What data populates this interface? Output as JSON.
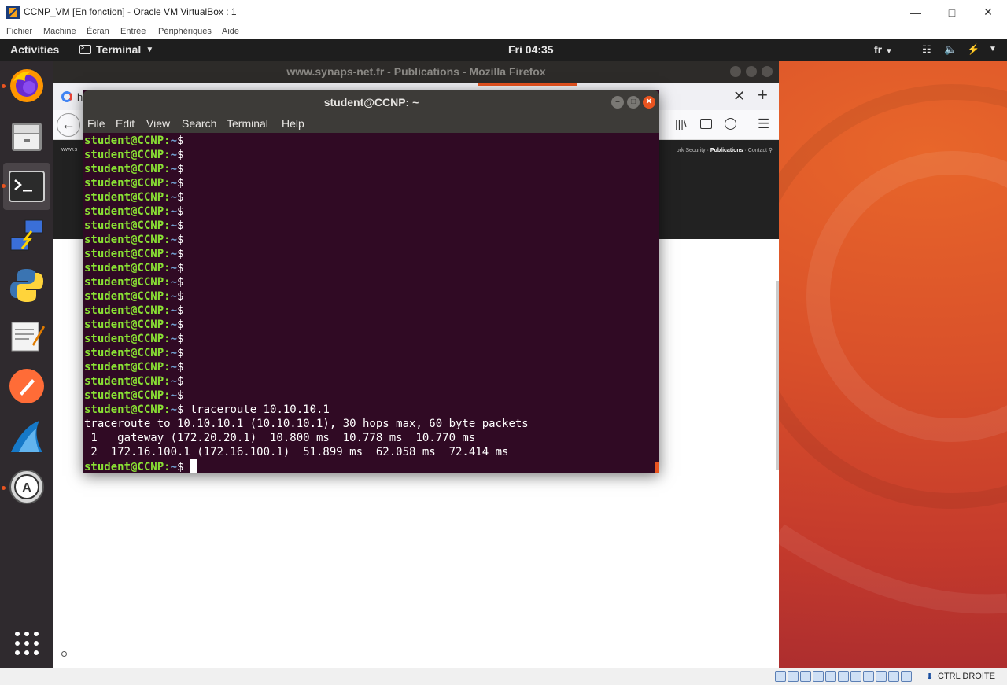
{
  "vbox": {
    "title": "CCNP_VM [En fonction] - Oracle VM VirtualBox : 1",
    "menu": [
      "Fichier",
      "Machine",
      "Écran",
      "Entrée",
      "Périphériques",
      "Aide"
    ],
    "host_key": "CTRL DROITE"
  },
  "topbar": {
    "activities": "Activities",
    "app_name": "Terminal",
    "clock": "Fri 04:35",
    "language": "fr"
  },
  "dock": {
    "items": [
      "firefox-icon",
      "files-icon",
      "terminal-icon",
      "network-icon",
      "python-icon",
      "text-editor-icon",
      "postman-icon",
      "wireshark-icon",
      "software-updater-icon"
    ]
  },
  "firefox": {
    "title": "www.synaps-net.fr - Publications - Mozilla Firefox",
    "tab_label": "h",
    "site_text": "www.s",
    "nav_links": [
      "ork Security",
      "Publications",
      "Contact"
    ]
  },
  "terminal": {
    "title": "student@CCNP: ~",
    "menu": [
      "File",
      "Edit",
      "View",
      "Search",
      "Terminal",
      "Help"
    ],
    "prompt_user": "student@CCNP",
    "prompt_sep": ":",
    "prompt_path": "~",
    "prompt_sign": "$",
    "empty_prompt_count": 19,
    "command": " traceroute 10.10.10.1",
    "output": [
      "traceroute to 10.10.10.1 (10.10.10.1), 30 hops max, 60 byte packets",
      " 1  _gateway (172.20.20.1)  10.800 ms  10.778 ms  10.770 ms",
      " 2  172.16.100.1 (172.16.100.1)  51.899 ms  62.058 ms  72.414 ms"
    ]
  },
  "colors": {
    "terminal_bg": "#300a24",
    "prompt_user": "#8ae234",
    "prompt_path": "#729fcf",
    "ubuntu_orange": "#e95420"
  }
}
